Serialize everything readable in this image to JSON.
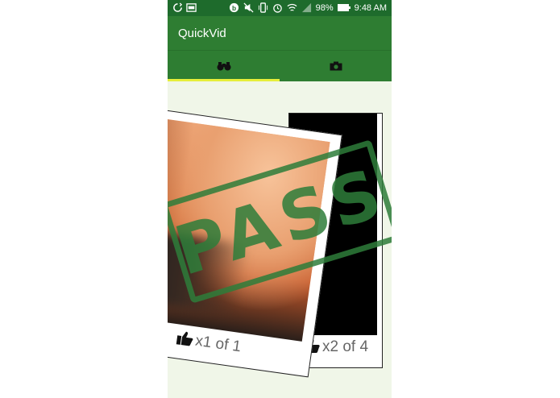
{
  "status": {
    "battery": "98%",
    "time": "9:48 AM"
  },
  "app": {
    "title": "QuickVid"
  },
  "tabs": [
    {
      "icon": "binoculars-icon",
      "selected": true
    },
    {
      "icon": "camera-icon",
      "selected": false
    }
  ],
  "cards": [
    {
      "caption": "x1 of 1"
    },
    {
      "caption": "x2 of 4"
    }
  ],
  "stamp": {
    "text": "PASS",
    "color": "#2e7d3a"
  },
  "colors": {
    "statusbar": "#1e6b2c",
    "appbar": "#2e7d32",
    "tab_indicator": "#e6ee3a",
    "background": "#f0f6e8"
  }
}
